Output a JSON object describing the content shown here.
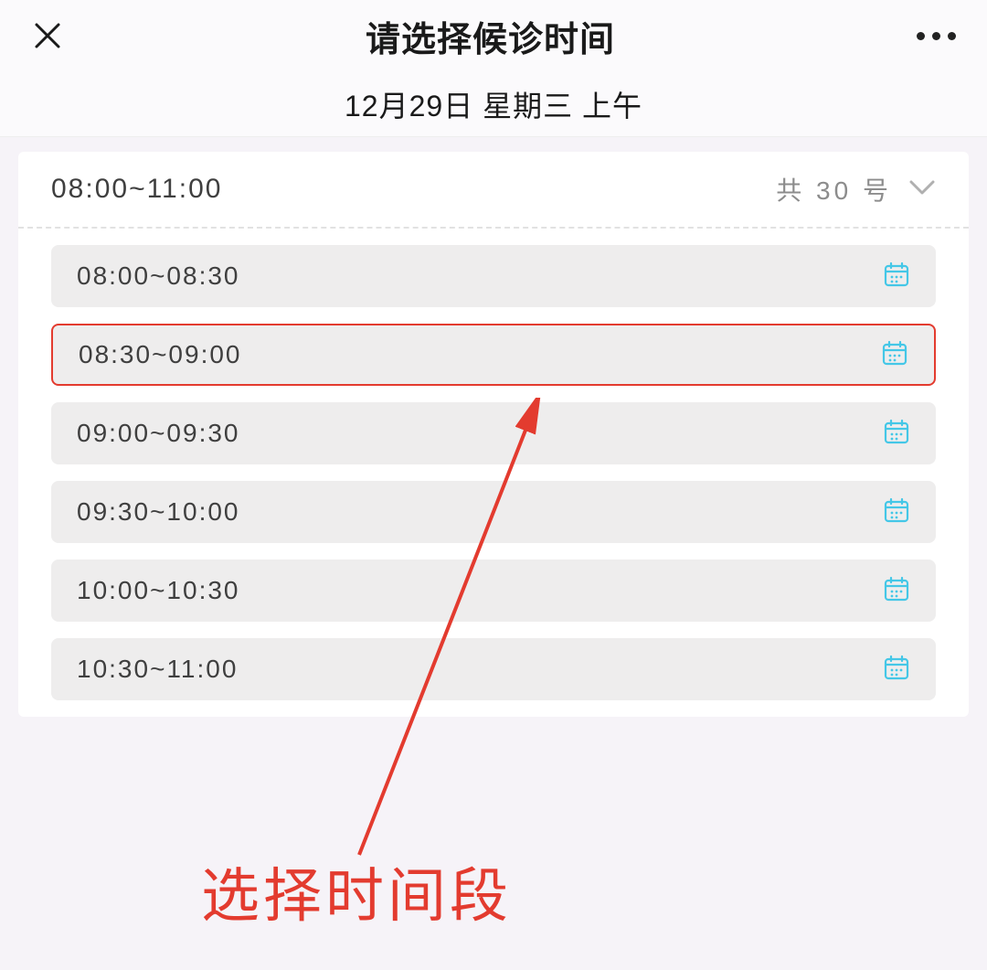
{
  "nav": {
    "title": "请选择候诊时间"
  },
  "date_bar": "12月29日  星期三  上午",
  "range": {
    "text": "08:00~11:00",
    "count": "共 30 号"
  },
  "slots": [
    {
      "label": "08:00~08:30",
      "selected": false
    },
    {
      "label": "08:30~09:00",
      "selected": true
    },
    {
      "label": "09:00~09:30",
      "selected": false
    },
    {
      "label": "09:30~10:00",
      "selected": false
    },
    {
      "label": "10:00~10:30",
      "selected": false
    },
    {
      "label": "10:30~11:00",
      "selected": false
    }
  ],
  "annotation": "选择时间段"
}
